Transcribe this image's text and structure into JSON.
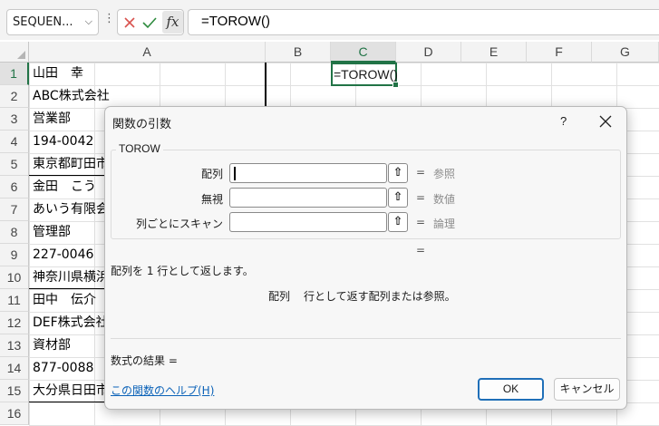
{
  "formula_bar": {
    "name_box": "SEQUEN...",
    "formula": "=TOROW()"
  },
  "columns": [
    "A",
    "B",
    "C",
    "D",
    "E",
    "F",
    "G"
  ],
  "rows": [
    "1",
    "2",
    "3",
    "4",
    "5",
    "6",
    "7",
    "8",
    "9",
    "10",
    "11",
    "12",
    "13",
    "14",
    "15",
    "16"
  ],
  "cells": {
    "a1": "山田　幸",
    "a2": "ABC株式会社",
    "a3": "営業部",
    "a4": "194-0042",
    "a5": "東京都町田市",
    "a6": "金田　こう",
    "a7": "あいう有限会",
    "a8": "管理部",
    "a9": "227-0046",
    "a10": "神奈川県横浜",
    "a11": "田中　伝介",
    "a12": "DEF株式会社",
    "a13": "資材部",
    "a14": "877-0088",
    "a15": "大分県日田市",
    "c1": "=TOROW()"
  },
  "dialog": {
    "title": "関数の引数",
    "help_glyph": "?",
    "function_name": "TOROW",
    "args": [
      {
        "label": "配列",
        "hint": "参照"
      },
      {
        "label": "無視",
        "hint": "数値"
      },
      {
        "label": "列ごとにスキャン",
        "hint": "論理"
      }
    ],
    "eq": "=",
    "description": "配列を 1 行として返します。",
    "arg_name": "配列",
    "arg_description": "行として返す配列または参照。",
    "result_label": "数式の結果 =",
    "help_link": "この関数のヘルプ(H)",
    "ok_label": "OK",
    "cancel_label": "キャンセル"
  }
}
